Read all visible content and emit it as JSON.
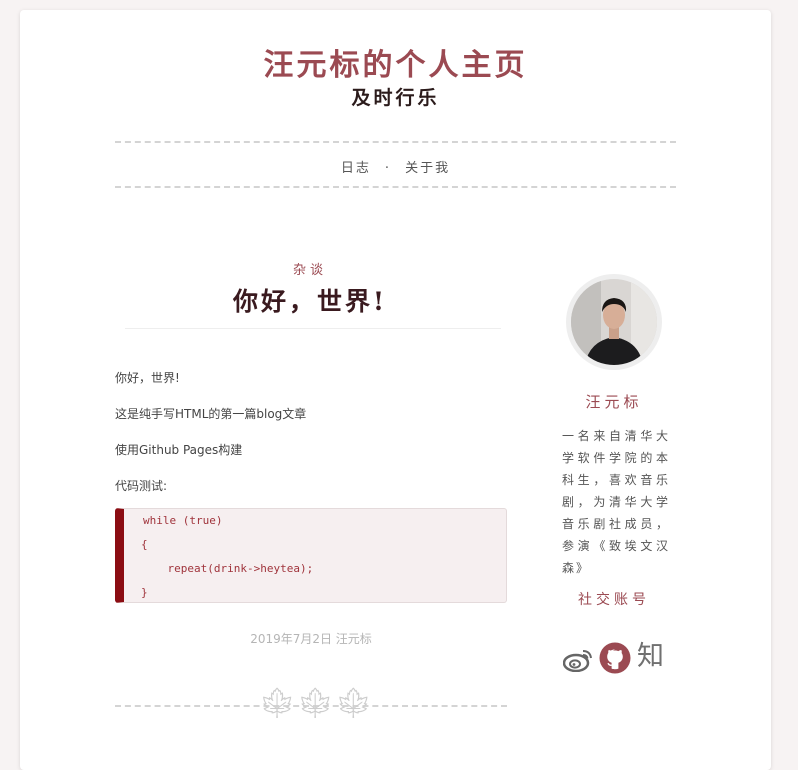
{
  "site": {
    "title": "汪元标的个人主页",
    "subtitle": "及时行乐"
  },
  "nav": {
    "items": [
      {
        "label": "日志"
      },
      {
        "label": "关于我"
      }
    ],
    "separator": "·"
  },
  "post": {
    "category": "杂谈",
    "title": "你好，世界!",
    "paragraphs": [
      "你好，世界!",
      "这是纯手写HTML的第一篇blog文章",
      "使用Github Pages构建",
      "代码测试:"
    ],
    "code": [
      "while (true)",
      "{",
      "    repeat(drink->heytea);",
      "}"
    ],
    "meta": "2019年7月2日 汪元标"
  },
  "sidebar": {
    "author_name": "汪元标",
    "bio": "一名来自清华大学软件学院的本科生，喜欢音乐剧，为清华大学音乐剧社成员，参演《致埃文汉森》",
    "social_title": "社交账号",
    "social_icons": [
      "weibo-icon",
      "github-icon",
      "zhihu-icon"
    ],
    "zhihu_glyph": "知"
  },
  "colors": {
    "accent": "#9b4a52",
    "code_bar": "#8b0d13",
    "divider": "#d4d4d4"
  }
}
